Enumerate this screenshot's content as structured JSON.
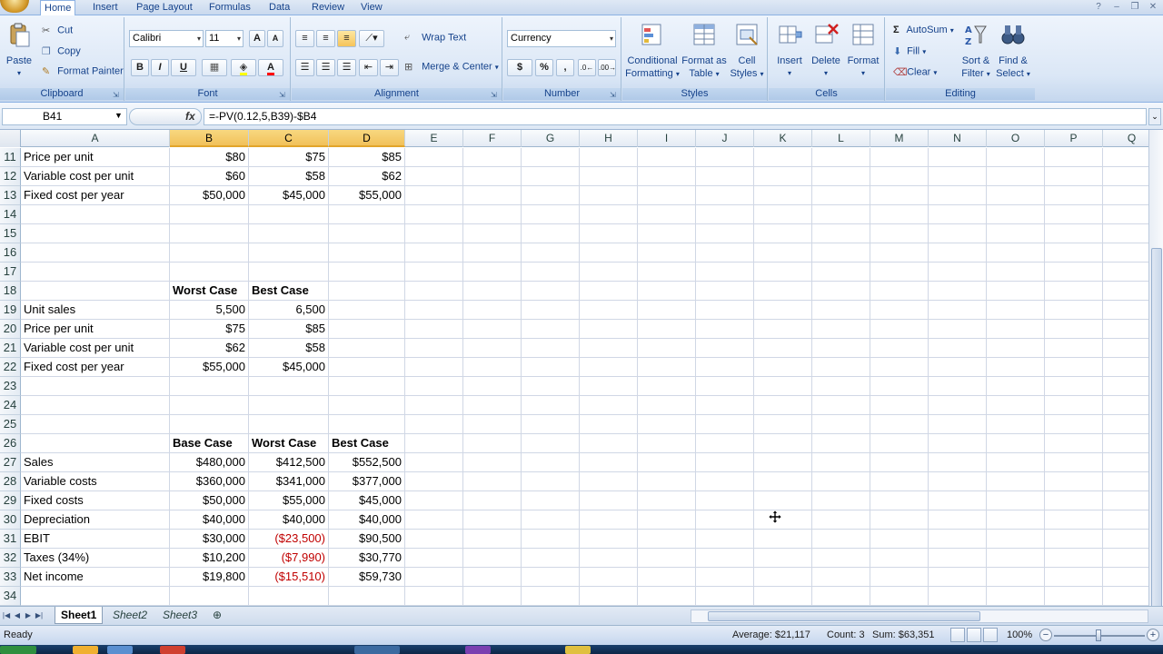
{
  "ribbon": {
    "tabs": [
      {
        "label": "Home",
        "active": true
      },
      {
        "label": "Insert"
      },
      {
        "label": "Page Layout"
      },
      {
        "label": "Formulas"
      },
      {
        "label": "Data"
      },
      {
        "label": "Review"
      },
      {
        "label": "View"
      }
    ],
    "clipboard": {
      "group": "Clipboard",
      "paste": "Paste",
      "cut": "Cut",
      "copy": "Copy",
      "format_painter": "Format Painter"
    },
    "font": {
      "group": "Font",
      "name": "Calibri",
      "size": "11",
      "bold": "B",
      "italic": "I",
      "underline": "U",
      "font_color": "A"
    },
    "alignment": {
      "group": "Alignment",
      "wrap_text": "Wrap Text",
      "merge_center": "Merge & Center"
    },
    "number": {
      "group": "Number",
      "format": "Currency",
      "dollar": "$",
      "percent": "%",
      "comma": ","
    },
    "styles": {
      "group": "Styles",
      "conditional": "Conditional",
      "formatting": "Formatting",
      "format_as": "Format as",
      "table": "Table",
      "cell": "Cell",
      "cell_styles": "Styles"
    },
    "cells": {
      "group": "Cells",
      "insert": "Insert",
      "delete": "Delete",
      "format": "Format"
    },
    "editing": {
      "group": "Editing",
      "autosum": "AutoSum",
      "fill": "Fill",
      "clear": "Clear",
      "sort": "Sort &",
      "filter": "Filter",
      "find": "Find &",
      "select": "Select"
    }
  },
  "formula_bar": {
    "name_box": "B41",
    "fx": "fx",
    "formula": "=-PV(0.12,5,B39)-$B4"
  },
  "columns": [
    "A",
    "B",
    "C",
    "D",
    "E",
    "F",
    "G",
    "H",
    "I",
    "J",
    "K",
    "L",
    "M",
    "N",
    "O",
    "P",
    "Q"
  ],
  "rows": [
    {
      "num": "11",
      "A": "Price per unit",
      "B": "$80",
      "C": "$75",
      "D": "$85"
    },
    {
      "num": "12",
      "A": "Variable cost per unit",
      "B": "$60",
      "C": "$58",
      "D": "$62"
    },
    {
      "num": "13",
      "A": "Fixed cost per year",
      "B": "$50,000",
      "C": "$45,000",
      "D": "$55,000"
    },
    {
      "num": "14"
    },
    {
      "num": "15"
    },
    {
      "num": "16"
    },
    {
      "num": "17"
    },
    {
      "num": "18",
      "B": "Worst Case",
      "C": "Best Case",
      "bold": true
    },
    {
      "num": "19",
      "A": "Unit sales",
      "B": "5,500",
      "C": "6,500"
    },
    {
      "num": "20",
      "A": "Price per unit",
      "B": "$75",
      "C": "$85"
    },
    {
      "num": "21",
      "A": "Variable cost per unit",
      "B": "$62",
      "C": "$58"
    },
    {
      "num": "22",
      "A": "Fixed cost per year",
      "B": "$55,000",
      "C": "$45,000"
    },
    {
      "num": "23"
    },
    {
      "num": "24"
    },
    {
      "num": "25"
    },
    {
      "num": "26",
      "B": "Base Case",
      "C": "Worst Case",
      "D": "Best Case",
      "bold": true
    },
    {
      "num": "27",
      "A": "Sales",
      "B": "$480,000",
      "C": "$412,500",
      "D": "$552,500"
    },
    {
      "num": "28",
      "A": "Variable costs",
      "B": "$360,000",
      "C": "$341,000",
      "D": "$377,000"
    },
    {
      "num": "29",
      "A": "Fixed costs",
      "B": "$50,000",
      "C": "$55,000",
      "D": "$45,000"
    },
    {
      "num": "30",
      "A": "Depreciation",
      "B": "$40,000",
      "C": "$40,000",
      "D": "$40,000"
    },
    {
      "num": "31",
      "A": "EBIT",
      "B": "$30,000",
      "C": "($23,500)",
      "D": "$90,500",
      "negC": true
    },
    {
      "num": "32",
      "A": "Taxes (34%)",
      "B": "$10,200",
      "C": "($7,990)",
      "D": "$30,770",
      "negC": true
    },
    {
      "num": "33",
      "A": "Net income",
      "B": "$19,800",
      "C": "($15,510)",
      "D": "$59,730",
      "negC": true
    },
    {
      "num": "34"
    }
  ],
  "sheets": [
    {
      "label": "Sheet1",
      "active": true
    },
    {
      "label": "Sheet2"
    },
    {
      "label": "Sheet3"
    }
  ],
  "status": {
    "ready": "Ready",
    "average": "Average: $21,117",
    "count": "Count: 3",
    "sum": "Sum: $63,351",
    "zoom": "100%"
  },
  "colors": {
    "accent": "#15428b",
    "negative": "#c00000",
    "selected_header": "#f1c15a"
  }
}
